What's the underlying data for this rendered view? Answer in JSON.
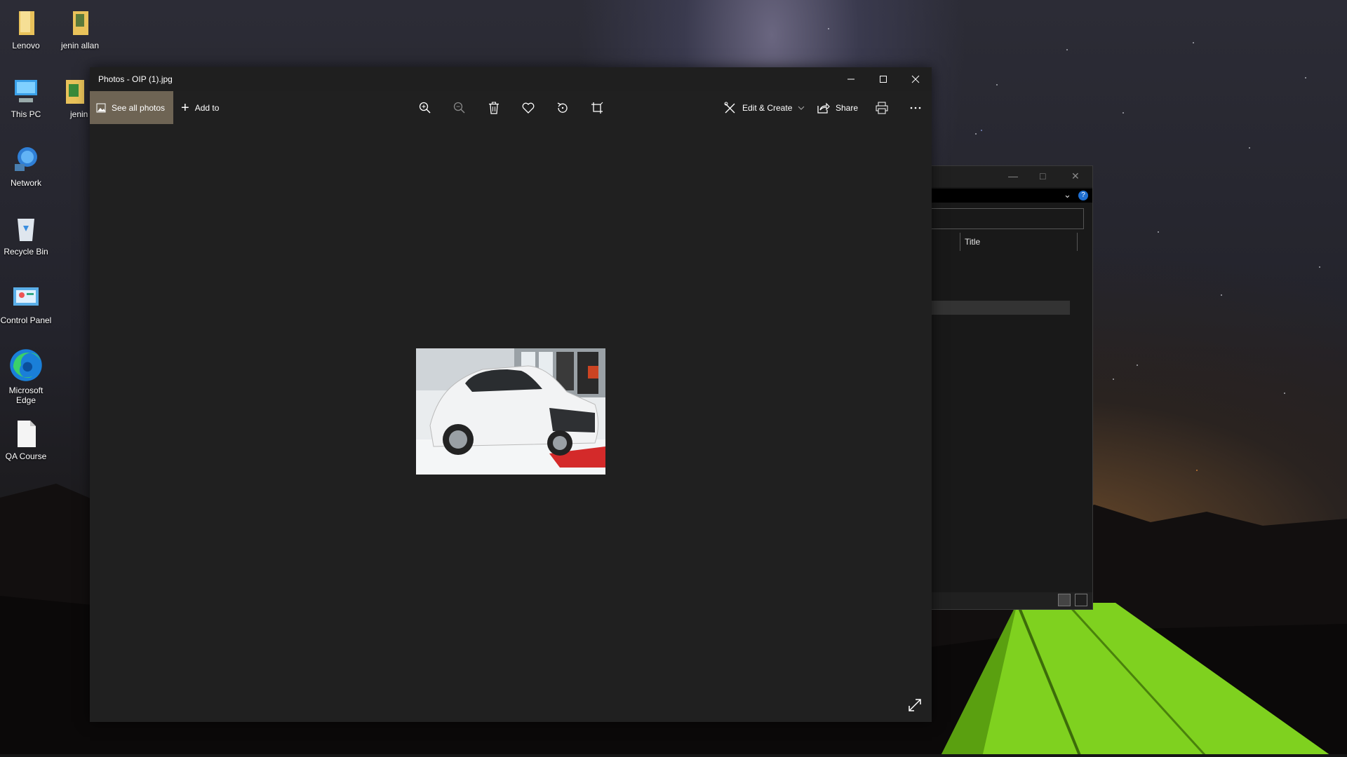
{
  "desktop": {
    "icons": [
      {
        "label": "Lenovo",
        "icon": "folder-icon"
      },
      {
        "label": "jenin allan",
        "icon": "folder-icon"
      },
      {
        "label": "This PC",
        "icon": "computer-icon"
      },
      {
        "label": "jenin",
        "icon": "folder-icon"
      },
      {
        "label": "Network",
        "icon": "network-icon"
      },
      {
        "label": "Recycle Bin",
        "icon": "recycle-bin-icon"
      },
      {
        "label": "Control Panel",
        "icon": "control-panel-icon"
      },
      {
        "label": "Microsoft Edge",
        "icon": "edge-icon"
      },
      {
        "label": "QA Course",
        "icon": "document-icon"
      }
    ]
  },
  "photos_window": {
    "title": "Photos - OIP (1).jpg",
    "toolbar": {
      "see_all_photos": "See all photos",
      "add_to": "Add to",
      "edit_create": "Edit & Create",
      "share": "Share",
      "icons": [
        "zoom-in-icon",
        "zoom-out-icon",
        "delete-icon",
        "favorite-icon",
        "rotate-icon",
        "crop-icon",
        "print-icon",
        "more-icon"
      ]
    }
  },
  "explorer_window": {
    "column_header": "Title"
  },
  "colors": {
    "photos_bg": "#202020",
    "see_all_bg": "#6e6454",
    "help_blue": "#1f6fd1"
  }
}
